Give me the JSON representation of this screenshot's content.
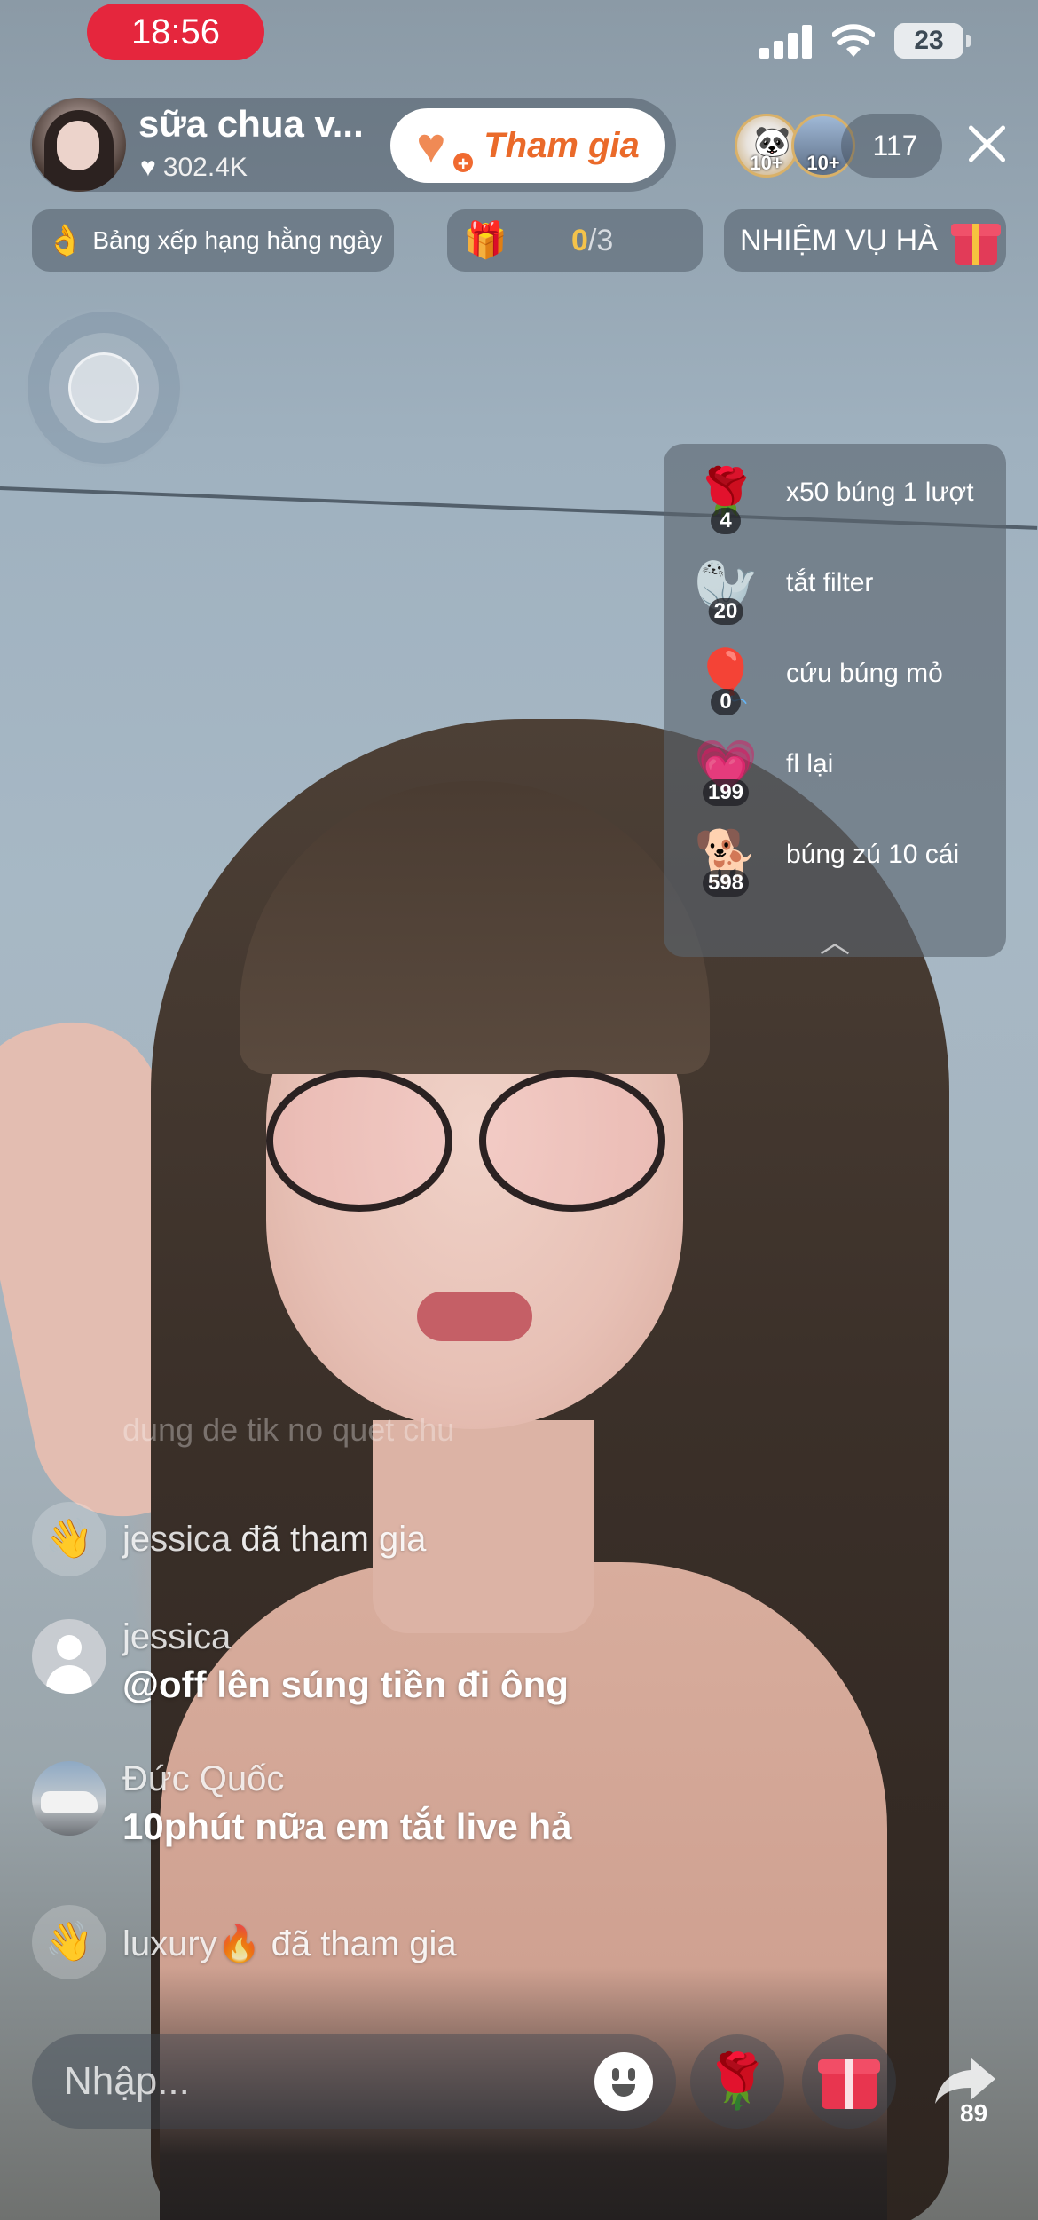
{
  "status_bar": {
    "time": "18:56",
    "battery": "23"
  },
  "host": {
    "name": "sữa chua v...",
    "likes": "302.4K",
    "join_label": "Tham gia"
  },
  "viewers": {
    "badge_1": "10+",
    "badge_2": "10+",
    "count": "117"
  },
  "top_pills": {
    "ranking": "Bảng xếp hạng hằng ngày",
    "gift_progress_current": "0",
    "gift_progress_total": "/3",
    "tasks": "NHIỆM VỤ HÀ"
  },
  "gift_goals": [
    {
      "icon": "rose-icon",
      "count": "4",
      "label": "x50 búng 1 lượt"
    },
    {
      "icon": "seal-icon",
      "count": "20",
      "label": "tắt filter"
    },
    {
      "icon": "balloons-icon",
      "count": "0",
      "label": "cứu búng mỏ"
    },
    {
      "icon": "heart-icon",
      "count": "199",
      "label": "fl lại"
    },
    {
      "icon": "corgi-icon",
      "count": "598",
      "label": "búng zú 10 cái"
    }
  ],
  "chat": {
    "faded": "dung de tik no quet chu",
    "items": [
      {
        "name": "jessica",
        "text": "đã tham gia"
      },
      {
        "name": "jessica",
        "text": "@off lên súng tiền đi ông"
      },
      {
        "name": "Đức Quốc",
        "text": "10phút nữa em tắt live hả"
      },
      {
        "name": "luxury🔥",
        "text": "đã tham gia"
      }
    ]
  },
  "bottom": {
    "input_placeholder": "Nhập...",
    "share_count": "89"
  },
  "colors": {
    "live_red": "#e5263d",
    "join_orange": "#ea6a2a",
    "progress_yellow": "#f5c34a"
  }
}
